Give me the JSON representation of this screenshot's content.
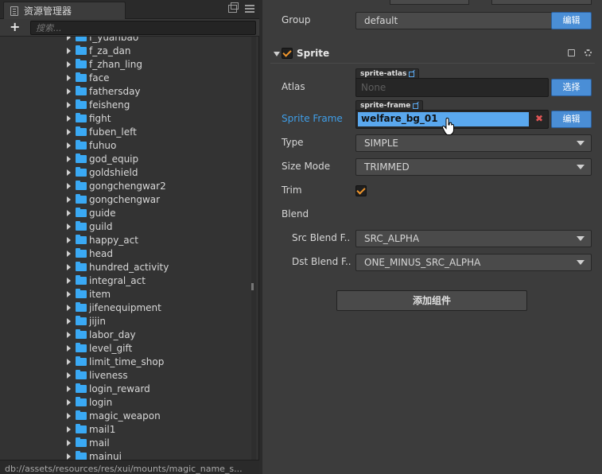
{
  "assets_panel": {
    "title": "资源管理器",
    "search_placeholder": "搜索...",
    "add_label": "+",
    "items": [
      {
        "label": "f_yuanbao"
      },
      {
        "label": "f_za_dan"
      },
      {
        "label": "f_zhan_ling"
      },
      {
        "label": "face"
      },
      {
        "label": "fathersday"
      },
      {
        "label": "feisheng"
      },
      {
        "label": "fight"
      },
      {
        "label": "fuben_left"
      },
      {
        "label": "fuhuo"
      },
      {
        "label": "god_equip"
      },
      {
        "label": "goldshield"
      },
      {
        "label": "gongchengwar2"
      },
      {
        "label": "gongchengwar"
      },
      {
        "label": "guide"
      },
      {
        "label": "guild"
      },
      {
        "label": "happy_act"
      },
      {
        "label": "head"
      },
      {
        "label": "hundred_activity"
      },
      {
        "label": "integral_act"
      },
      {
        "label": "item"
      },
      {
        "label": "jifenequipment"
      },
      {
        "label": "jijin"
      },
      {
        "label": "labor_day"
      },
      {
        "label": "level_gift"
      },
      {
        "label": "limit_time_shop"
      },
      {
        "label": "liveness"
      },
      {
        "label": "login_reward"
      },
      {
        "label": "login"
      },
      {
        "label": "magic_weapon"
      },
      {
        "label": "mail1"
      },
      {
        "label": "mail"
      },
      {
        "label": "mainui"
      }
    ],
    "status_path": "db://assets/resources/res/xui/mounts/magic_name_s..."
  },
  "inspector": {
    "group": {
      "label": "Group",
      "value": "default",
      "edit_label": "编辑"
    },
    "sprite": {
      "title": "Sprite",
      "atlas": {
        "label": "Atlas",
        "tag": "sprite-atlas",
        "value": "None",
        "button": "选择"
      },
      "sprite_frame": {
        "label": "Sprite Frame",
        "tag": "sprite-frame",
        "value": "welfare_bg_01",
        "clear": "✖",
        "button": "编辑"
      },
      "type": {
        "label": "Type",
        "value": "SIMPLE"
      },
      "size_mode": {
        "label": "Size Mode",
        "value": "TRIMMED"
      },
      "trim": {
        "label": "Trim",
        "checked": true
      },
      "blend": {
        "label": "Blend"
      },
      "src_blend": {
        "label": "Src Blend F..",
        "value": "SRC_ALPHA"
      },
      "dst_blend": {
        "label": "Dst Blend F..",
        "value": "ONE_MINUS_SRC_ALPHA"
      }
    },
    "add_component_label": "添加组件"
  },
  "colors": {
    "accent": "#4a8ed6",
    "highlight": "#5aa8ee",
    "folder": "#3aa9f4",
    "check": "#f0962c"
  }
}
